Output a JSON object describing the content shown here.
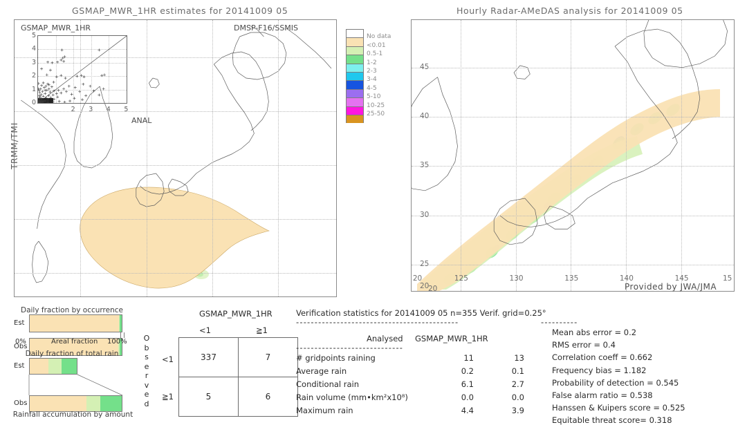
{
  "left_panel": {
    "title": "GSMAP_MWR_1HR estimates for 20141009 05",
    "tag_topleft": "GSMAP_MWR_1HR",
    "tag_topright": "DMSP-F16/SSMIS",
    "tag_anal": "ANAL",
    "side_label": "TRMM/TMI"
  },
  "right_panel": {
    "title": "Hourly Radar-AMeDAS analysis for 20141009 05",
    "credit": "Provided by JWA/JMA",
    "x_ticks": [
      "20",
      "125",
      "130",
      "135",
      "140",
      "145",
      "15"
    ],
    "y_ticks": [
      "45",
      "40",
      "35",
      "30",
      "25",
      "20"
    ],
    "corner_tick": "20"
  },
  "colorbar": {
    "labels": [
      "No data",
      "<0.01",
      "0.5-1",
      "1-2",
      "2-3",
      "3-4",
      "4-5",
      "5-10",
      "10-25",
      "25-50"
    ],
    "colors": [
      "#ffffff",
      "#fae2b4",
      "#d4f0b4",
      "#74e08a",
      "#7df0ee",
      "#1fc8ee",
      "#1654e0",
      "#9b6ef0",
      "#e472f0",
      "#ff16e0",
      "#d99420"
    ]
  },
  "scatter_inset": {
    "x_ticks": [
      "2",
      "3",
      "4",
      "5"
    ],
    "y_ticks": [
      "0",
      "1",
      "2",
      "3",
      "4",
      "5"
    ],
    "points": [
      [
        0.02,
        0.02
      ],
      [
        0.05,
        0.03
      ],
      [
        0.08,
        0.02
      ],
      [
        0.12,
        0.04
      ],
      [
        0.03,
        0.08
      ],
      [
        0.06,
        0.12
      ],
      [
        0.1,
        0.09
      ],
      [
        0.15,
        0.06
      ],
      [
        0.2,
        0.05
      ],
      [
        0.04,
        0.2
      ],
      [
        0.09,
        0.25
      ],
      [
        0.18,
        0.18
      ],
      [
        0.25,
        0.12
      ],
      [
        0.3,
        0.08
      ],
      [
        0.05,
        0.35
      ],
      [
        0.12,
        0.42
      ],
      [
        0.22,
        0.3
      ],
      [
        0.35,
        0.2
      ],
      [
        0.42,
        0.15
      ],
      [
        0.08,
        0.55
      ],
      [
        0.18,
        0.62
      ],
      [
        0.3,
        0.5
      ],
      [
        0.45,
        0.38
      ],
      [
        0.55,
        0.25
      ],
      [
        0.1,
        0.78
      ],
      [
        0.25,
        0.85
      ],
      [
        0.4,
        0.7
      ],
      [
        0.6,
        0.55
      ],
      [
        0.72,
        0.4
      ],
      [
        0.15,
        1.05
      ],
      [
        0.35,
        1.15
      ],
      [
        0.5,
        0.95
      ],
      [
        0.68,
        0.82
      ],
      [
        0.85,
        0.6
      ],
      [
        0.2,
        1.3
      ],
      [
        0.45,
        1.25
      ],
      [
        0.62,
        1.05
      ],
      [
        0.9,
        0.9
      ],
      [
        1.05,
        0.7
      ],
      [
        0.3,
        1.5
      ],
      [
        0.55,
        1.42
      ],
      [
        0.78,
        1.2
      ],
      [
        1.15,
        0.95
      ],
      [
        1.3,
        0.75
      ],
      [
        0.4,
        0.95
      ],
      [
        0.62,
        1.35
      ],
      [
        0.88,
        1.55
      ],
      [
        1.45,
        1.05
      ],
      [
        1.6,
        0.85
      ],
      [
        1.75,
        1.25
      ],
      [
        1.9,
        0.65
      ],
      [
        2.1,
        1.15
      ],
      [
        2.35,
        0.85
      ],
      [
        2.55,
        1.4
      ],
      [
        2.7,
        0.55
      ],
      [
        2.95,
        1.25
      ],
      [
        3.15,
        0.9
      ],
      [
        3.45,
        0.6
      ],
      [
        3.7,
        1.05
      ],
      [
        1.05,
        1.95
      ],
      [
        1.3,
        2.05
      ],
      [
        1.55,
        1.85
      ],
      [
        2.2,
        2.0
      ],
      [
        2.45,
        2.05
      ],
      [
        2.6,
        1.95
      ],
      [
        3.6,
        2.05
      ],
      [
        3.75,
        2.1
      ],
      [
        1.1,
        3.05
      ],
      [
        1.3,
        3.2
      ],
      [
        1.4,
        3.35
      ],
      [
        1.5,
        3.45
      ],
      [
        1.45,
        3.1
      ],
      [
        0.55,
        3.05
      ],
      [
        0.8,
        3.0
      ],
      [
        1.35,
        3.95
      ],
      [
        3.45,
        3.95
      ],
      [
        0.2,
        2.55
      ],
      [
        0.5,
        2.1
      ],
      [
        0.7,
        2.45
      ],
      [
        1.8,
        0.15
      ],
      [
        2.05,
        0.35
      ],
      [
        2.5,
        0.25
      ],
      [
        0.55,
        0.05
      ],
      [
        0.85,
        0.08
      ],
      [
        1.2,
        0.12
      ],
      [
        1.5,
        0.06
      ],
      [
        0.02,
        1.05
      ],
      [
        0.03,
        1.45
      ],
      [
        0.06,
        0.95
      ],
      [
        0.9,
        0.28
      ],
      [
        1.1,
        0.45
      ]
    ]
  },
  "bar_occurrence": {
    "title": "Daily fraction by occurrence",
    "axis_left": "0%",
    "axis_center": "Areal fraction",
    "axis_right": "100%",
    "rows": [
      {
        "label": "Est",
        "segments": [
          {
            "color": "#fae2b4",
            "pct": 96.8
          },
          {
            "color": "#d4f0b4",
            "pct": 1.1
          },
          {
            "color": "#74e08a",
            "pct": 2.1
          }
        ]
      },
      {
        "label": "Obs",
        "segments": [
          {
            "color": "#fae2b4",
            "pct": 96.2
          },
          {
            "color": "#d4f0b4",
            "pct": 1.2
          },
          {
            "color": "#74e08a",
            "pct": 2.6
          }
        ]
      }
    ]
  },
  "bar_total_rain": {
    "title": "Daily fraction of total rain",
    "caption": "Rainfall accumulation by amount",
    "rows": [
      {
        "label": "Est",
        "width_pct": 52,
        "segments": [
          {
            "color": "#fae2b4",
            "pct": 40
          },
          {
            "color": "#d4f0b4",
            "pct": 27
          },
          {
            "color": "#74e08a",
            "pct": 33
          }
        ]
      },
      {
        "label": "Obs",
        "width_pct": 100,
        "segments": [
          {
            "color": "#fae2b4",
            "pct": 62
          },
          {
            "color": "#d4f0b4",
            "pct": 15
          },
          {
            "color": "#74e08a",
            "pct": 23
          }
        ]
      }
    ]
  },
  "contingency": {
    "header": "GSMAP_MWR_1HR",
    "col_headers": [
      "<1",
      "≧1"
    ],
    "row_headers": [
      "<1",
      "≧1"
    ],
    "side_label": "Observed",
    "cells": [
      [
        "337",
        "7"
      ],
      [
        "5",
        "6"
      ]
    ]
  },
  "verification": {
    "header": "Verification statistics for 20141009 05   n=355  Verif. grid=0.25°",
    "rule_long": "--------------------------------------------",
    "rule_short": "-----------------------------",
    "col_analysed": "Analysed",
    "col_model": "GSMAP_MWR_1HR",
    "rows": [
      {
        "label": "# gridpoints raining",
        "analysed": "11",
        "model": "13"
      },
      {
        "label": "Average rain",
        "analysed": "0.2",
        "model": "0.1"
      },
      {
        "label": "Conditional rain",
        "analysed": "6.1",
        "model": "2.7"
      },
      {
        "label": "Rain volume (mm•km²x10⁸)",
        "analysed": "0.0",
        "model": "0.0"
      },
      {
        "label": "Maximum rain",
        "analysed": "4.4",
        "model": "3.9"
      }
    ]
  },
  "scores": {
    "rule": "----------",
    "items": [
      "Mean abs error = 0.2",
      "RMS error = 0.4",
      "Correlation coeff = 0.662",
      "Frequency bias = 1.182",
      "Probability of detection = 0.545",
      "False alarm ratio = 0.538",
      "Hanssen & Kuipers score = 0.525",
      "Equitable threat score= 0.318"
    ]
  }
}
